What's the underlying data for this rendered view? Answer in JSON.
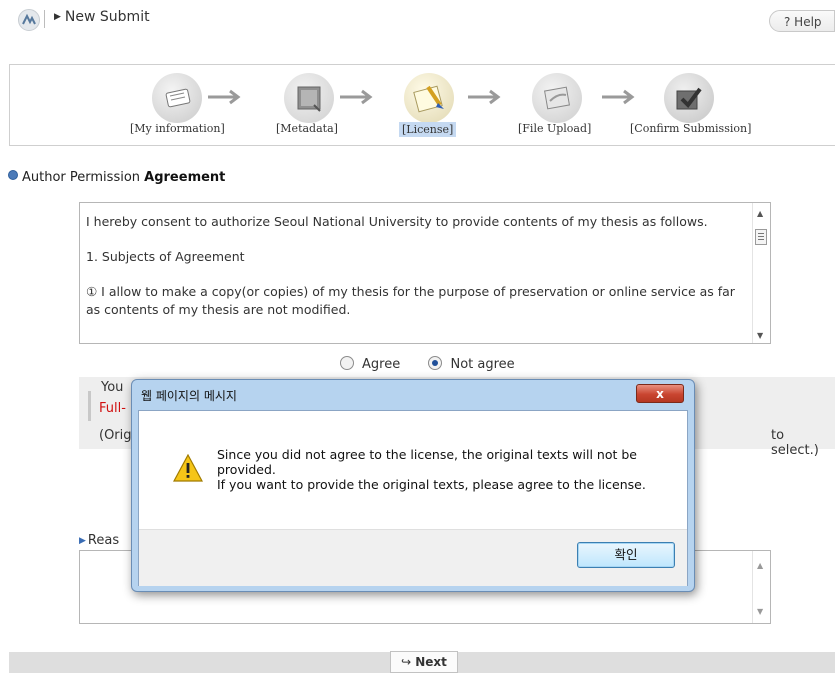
{
  "header": {
    "title": "New Submit",
    "help_label": "? Help"
  },
  "steps": [
    {
      "label": "[My information]",
      "icon": "profile-document-icon"
    },
    {
      "label": "[Metadata]",
      "icon": "metadata-icon"
    },
    {
      "label": "[License]",
      "icon": "license-pen-icon",
      "active": true
    },
    {
      "label": "[File Upload]",
      "icon": "file-upload-icon"
    },
    {
      "label": "[Confirm Submission]",
      "icon": "confirm-check-icon"
    }
  ],
  "section": {
    "prefix": "Author Permission",
    "bold": "Agreement"
  },
  "agreement": {
    "para1": "I hereby consent to authorize Seoul National University to provide contents of my thesis as follows.",
    "para2": "1. Subjects of Agreement",
    "para3": "① I allow to make a copy(or copies) of my thesis for the purpose of preservation or online service as far as contents of my thesis are not modified."
  },
  "radios": {
    "agree": "Agree",
    "not_agree": "Not agree",
    "selected": "not_agree"
  },
  "notice": {
    "line1_visible": "You",
    "line2_visible": "Full-",
    "line3_visible": "(Orig",
    "line3_end": "to select.)"
  },
  "reason": {
    "label_visible": "Reas"
  },
  "bottom": {
    "next_label": "Next"
  },
  "dialog": {
    "title": "웹 페이지의 메시지",
    "close_label": "x",
    "message_line1": "Since you did not agree to the license, the original texts will not be",
    "message_line2": "provided.",
    "message_line3": "If you want to provide the original texts, please agree to the license.",
    "ok_label": "확인",
    "icon": "warning-icon"
  },
  "colors": {
    "accent": "#c5d9f1",
    "notice_red": "#d01010",
    "dialog_frame": "#b6d3ef",
    "close_red": "#c94530"
  }
}
